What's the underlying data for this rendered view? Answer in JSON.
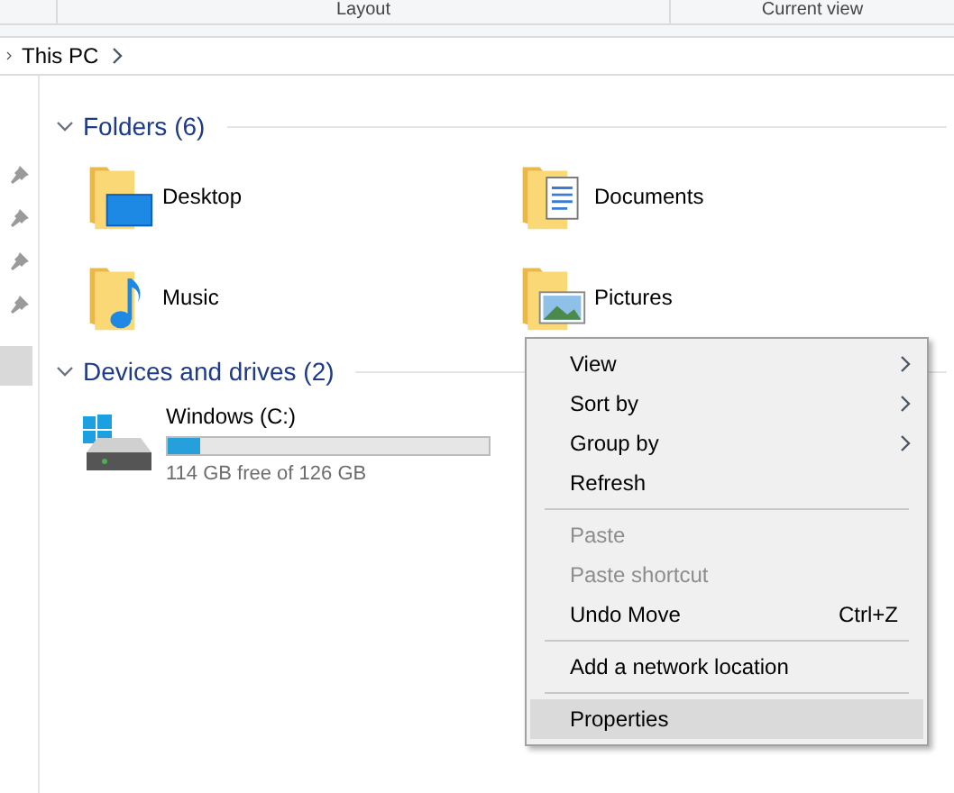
{
  "ribbon": {
    "groups": [
      "Layout",
      "Current view"
    ]
  },
  "breadcrumb": [
    "This PC"
  ],
  "sections": [
    {
      "title": "Folders (6)",
      "expanded": true,
      "kind": "folders",
      "items": [
        {
          "name": "Desktop",
          "kind": "desktop"
        },
        {
          "name": "Documents",
          "kind": "documents"
        },
        {
          "name": "Music",
          "kind": "music"
        },
        {
          "name": "Pictures",
          "kind": "pictures"
        }
      ]
    },
    {
      "title": "Devices and drives (2)",
      "expanded": true,
      "kind": "drives",
      "items": [
        {
          "name": "Windows (C:)",
          "level": 0.1,
          "free": "114 GB free of 126 GB"
        }
      ]
    }
  ],
  "context_menu": {
    "sections": [
      [
        {
          "label": "View",
          "submenu": true,
          "disabled": false,
          "selected": false
        },
        {
          "label": "Sort by",
          "submenu": true,
          "disabled": false,
          "selected": false
        },
        {
          "label": "Group by",
          "submenu": true,
          "disabled": false,
          "selected": false
        },
        {
          "label": "Refresh",
          "submenu": false,
          "disabled": false,
          "selected": false
        }
      ],
      [
        {
          "label": "Paste",
          "submenu": false,
          "disabled": true,
          "selected": false
        },
        {
          "label": "Paste shortcut",
          "submenu": false,
          "disabled": true,
          "selected": false
        },
        {
          "label": "Undo Move",
          "shortcut": "Ctrl+Z",
          "submenu": false,
          "disabled": false,
          "selected": false
        }
      ],
      [
        {
          "label": "Add a network location",
          "submenu": false,
          "disabled": false,
          "selected": false
        }
      ],
      [
        {
          "label": "Properties",
          "submenu": false,
          "disabled": false,
          "selected": true
        }
      ]
    ]
  }
}
